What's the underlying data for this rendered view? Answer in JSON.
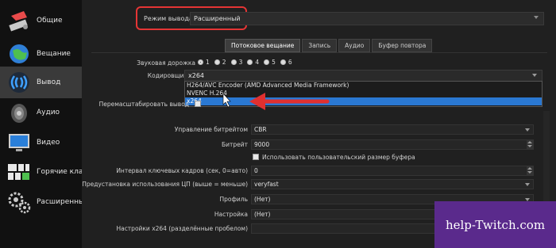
{
  "sidebar": {
    "items": [
      {
        "label": "Общие",
        "icon": "wrench-icon"
      },
      {
        "label": "Вещание",
        "icon": "globe-icon"
      },
      {
        "label": "Вывод",
        "icon": "output-icon",
        "active": true
      },
      {
        "label": "Аудио",
        "icon": "speaker-icon"
      },
      {
        "label": "Видео",
        "icon": "monitor-icon"
      },
      {
        "label": "Горячие клавиши",
        "icon": "keyboard-icon"
      },
      {
        "label": "Расширенные",
        "icon": "gears-icon"
      }
    ]
  },
  "output_mode": {
    "label": "Режим вывода",
    "value": "Расширенный"
  },
  "tabs": [
    {
      "label": "Потоковое вещание",
      "active": true
    },
    {
      "label": "Запись"
    },
    {
      "label": "Аудио"
    },
    {
      "label": "Буфер повтора"
    }
  ],
  "audio_track": {
    "label": "Звуковая дорожка",
    "tracks": [
      "1",
      "2",
      "3",
      "4",
      "5",
      "6"
    ],
    "selected": "1"
  },
  "encoder": {
    "label": "Кодировщик",
    "value": "x264",
    "options": [
      "H264/AVC Encoder (AMD Advanced Media Framework)",
      "NVENC H.264",
      "x264"
    ],
    "selected_option": "x264"
  },
  "rescale": {
    "label": "Перемасштабировать вывод"
  },
  "settings": {
    "rate_control": {
      "label": "Управление битрейтом",
      "value": "CBR"
    },
    "bitrate": {
      "label": "Битрейт",
      "value": "9000"
    },
    "custom_buffer": {
      "label": "Использовать пользовательский размер буфера"
    },
    "keyframe_interval": {
      "label": "Интервал ключевых кадров (сек, 0=авто)",
      "value": "0"
    },
    "cpu_preset": {
      "label": "Предустановка использования ЦП (выше = меньше)",
      "value": "veryfast"
    },
    "profile": {
      "label": "Профиль",
      "value": "(Нет)"
    },
    "tune": {
      "label": "Настройка",
      "value": "(Нет)"
    },
    "x264_opts": {
      "label": "Настройки x264 (разделённые пробелом)",
      "value": ""
    }
  },
  "watermark": "help-Twitch.com",
  "colors": {
    "highlight_box": "#e53535",
    "selected_option": "#2a78d2",
    "arrow": "#e03030",
    "watermark_bg": "#5a2a8c"
  }
}
